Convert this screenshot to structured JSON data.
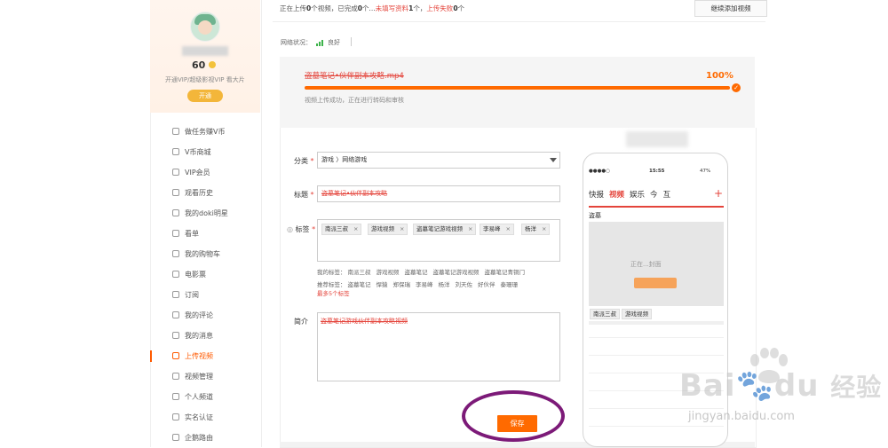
{
  "profile": {
    "level": "60",
    "vip_text": "开通VIP/超级影视VIP 看大片",
    "open_button": "开通"
  },
  "sidebar": {
    "items": [
      {
        "label": "做任务赚V币",
        "icon": "task-icon"
      },
      {
        "label": "V币商城",
        "icon": "store-icon"
      },
      {
        "label": "VIP会员",
        "icon": "vip-icon"
      },
      {
        "label": "观看历史",
        "icon": "history-icon"
      },
      {
        "label": "我的doki明星",
        "icon": "heart-icon"
      },
      {
        "label": "看单",
        "icon": "list-icon"
      },
      {
        "label": "我的购物车",
        "icon": "cart-icon"
      },
      {
        "label": "电影票",
        "icon": "ticket-icon"
      },
      {
        "label": "订阅",
        "icon": "subscribe-icon"
      },
      {
        "label": "我的评论",
        "icon": "comment-icon"
      },
      {
        "label": "我的消息",
        "icon": "bell-icon"
      },
      {
        "label": "上传视频",
        "icon": "upload-icon"
      },
      {
        "label": "视频管理",
        "icon": "video-manage-icon"
      },
      {
        "label": "个人频道",
        "icon": "user-icon"
      },
      {
        "label": "实名认证",
        "icon": "shield-icon"
      },
      {
        "label": "企鹅路由",
        "icon": "router-icon"
      }
    ],
    "active_index": 11
  },
  "upload_status": {
    "uploading_prefix": "正在上传",
    "uploading_count": "0",
    "uploading_suffix": "个视频，已完成",
    "completed_count": "0",
    "completed_suffix": "个...",
    "incomplete_label": "未填写资料",
    "incomplete_count": "1",
    "incomplete_unit": "个，",
    "failed_label": "上传失败",
    "failed_count": "0",
    "failed_unit": "个",
    "continue_button": "继续添加视频"
  },
  "network": {
    "label": "网络状况：",
    "status": "良好"
  },
  "file": {
    "name": "盗墓笔记•伙伴副本攻略.mp4",
    "percent": "100%",
    "progress": 1.0,
    "status_text": "视频上传成功，正在进行转码和审核"
  },
  "form": {
    "category_label": "分类",
    "category_value": "游戏 〉网络游戏",
    "title_label": "标题",
    "title_value": "盗墓笔记•伙伴副本攻略",
    "tags_label": "标签",
    "tags": [
      "南派三叔",
      "游戏视频",
      "盗墓笔记游戏视频",
      "李易峰",
      "杨洋"
    ],
    "my_tags_label": "我的标签：",
    "my_tags": [
      "南派三叔",
      "游戏视频",
      "盗墓笔记",
      "盗墓笔记游戏视频",
      "盗墓笔记青铜门"
    ],
    "recommend_label": "推荐标签：",
    "recommend_tags": [
      "盗墓笔记",
      "悍猿",
      "郑保瑞",
      "李易峰",
      "杨洋",
      "刘天佐",
      "好伙伴",
      "秦珊珊"
    ],
    "max_tags": "最多5个标签",
    "intro_label": "简介",
    "intro_value": "盗墓笔记游戏伙伴副本攻略视频",
    "save_button": "保存"
  },
  "preview": {
    "time": "15:55",
    "battery": "47%",
    "nav": [
      "快报",
      "视频",
      "娱乐",
      "今",
      "互"
    ],
    "nav_active": "视频",
    "plus": "+",
    "section_title": "盗墓",
    "video_text": "正在...封面",
    "tags": [
      "南派三叔",
      "游戏视频"
    ]
  },
  "watermark": {
    "brand": "Bai",
    "brand2": "du",
    "brand_cn": "经验",
    "url": "jingyan.baidu.com"
  },
  "colors": {
    "accent": "#ff6a00",
    "highlight_circle": "#7c1a78",
    "error_red": "#e4443b",
    "network_green": "#3cb34a"
  }
}
